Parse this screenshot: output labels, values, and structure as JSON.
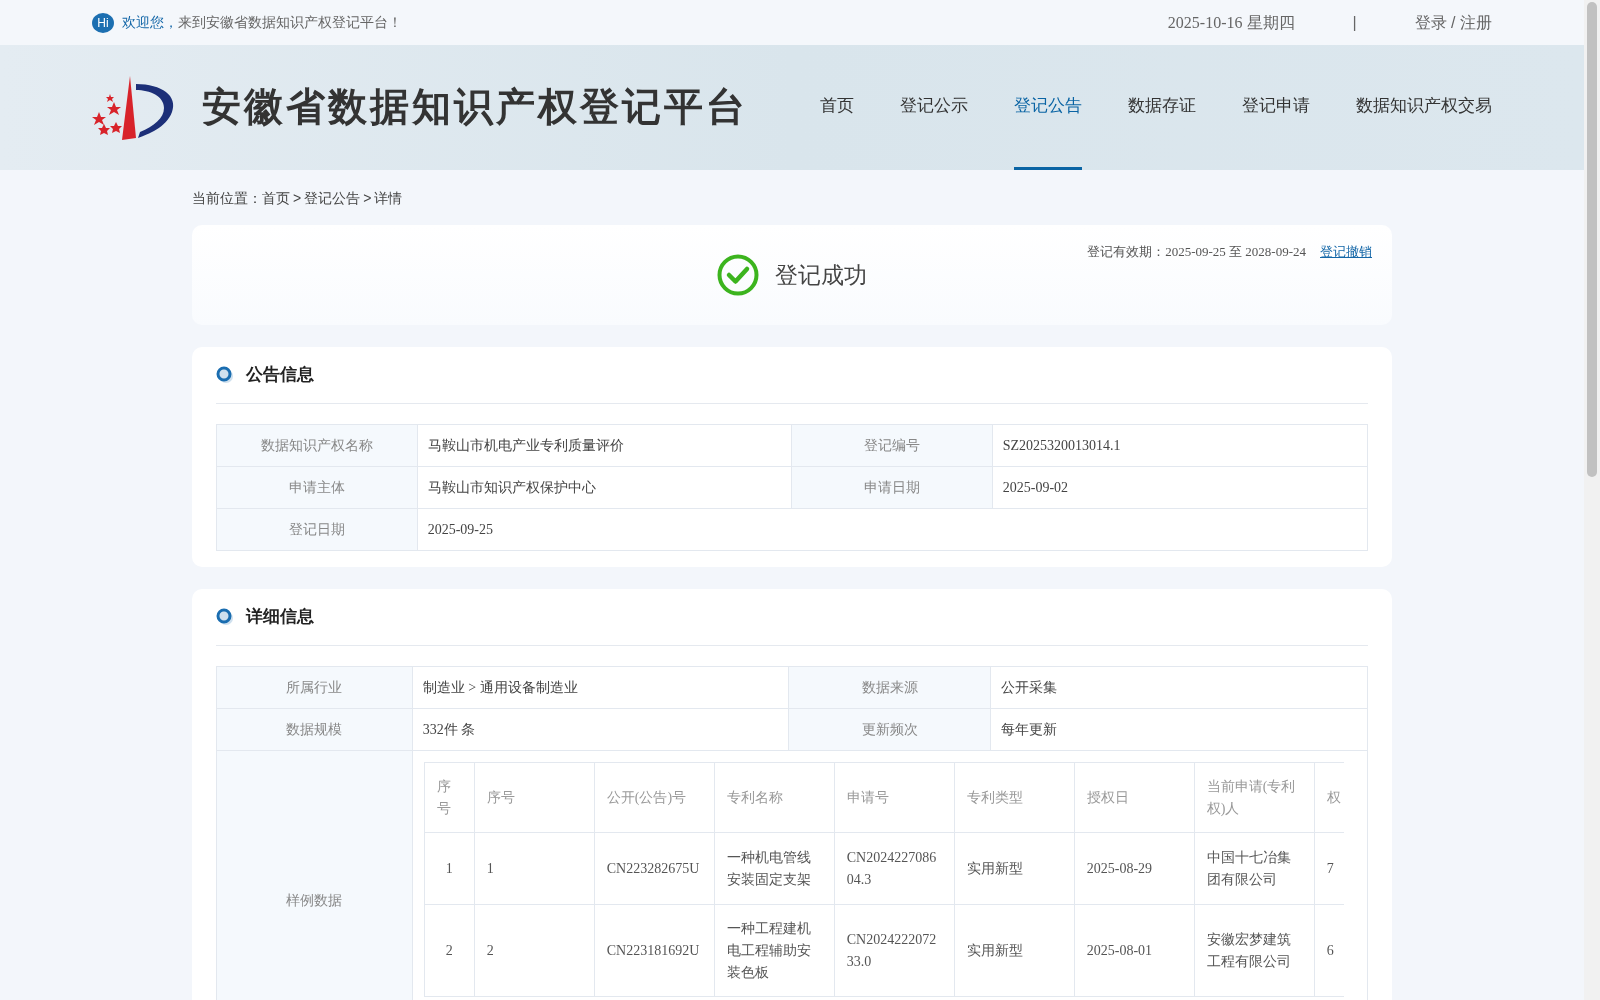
{
  "top_bar": {
    "hi_badge": "Hi",
    "welcome_highlight": "欢迎您，",
    "welcome_text": "来到安徽省数据知识产权登记平台！",
    "date": "2025-10-16 星期四",
    "separator": "|",
    "auth": "登录 / 注册"
  },
  "header": {
    "site_title": "安徽省数据知识产权登记平台",
    "nav": [
      {
        "label": "首页",
        "selected": false
      },
      {
        "label": "登记公示",
        "selected": false
      },
      {
        "label": "登记公告",
        "selected": true
      },
      {
        "label": "数据存证",
        "selected": false
      },
      {
        "label": "登记申请",
        "selected": false
      },
      {
        "label": "数据知识产权交易",
        "selected": false
      }
    ]
  },
  "breadcrumb": {
    "label": "当前位置：",
    "parts": [
      {
        "kind": "link",
        "text": "首页"
      },
      {
        "kind": "sep",
        "text": ">"
      },
      {
        "kind": "link",
        "text": "登记公告"
      },
      {
        "kind": "sep",
        "text": ">"
      },
      {
        "kind": "current",
        "text": "详情"
      }
    ]
  },
  "status": {
    "title": "登记成功",
    "validity_label": "登记有效期：",
    "validity": "2025-09-25 至 2028-09-24",
    "revoke_link": "登记撤销"
  },
  "sections": [
    {
      "title": "公告信息",
      "rows": [
        [
          {
            "label": "数据知识产权名称",
            "value": "马鞍山市机电产业专利质量评价"
          },
          {
            "label": "登记编号",
            "value": "SZ2025320013014.1"
          }
        ],
        [
          {
            "label": "申请主体",
            "value": "马鞍山市知识产权保护中心"
          },
          {
            "label": "申请日期",
            "value": "2025-09-02"
          }
        ],
        [
          {
            "label": "登记日期",
            "value": "2025-09-25"
          }
        ]
      ]
    },
    {
      "title": "详细信息",
      "rows": [
        [
          {
            "label": "所属行业",
            "value": "制造业 > 通用设备制造业"
          },
          {
            "label": "数据来源",
            "value": "公开采集"
          }
        ],
        [
          {
            "label": "数据规模",
            "value": "332件 条"
          },
          {
            "label": "更新频次",
            "value": "每年更新"
          }
        ]
      ],
      "sample": {
        "label": "样例数据",
        "columns": [
          "序号",
          "序号",
          "公开(公告)号",
          "专利名称",
          "申请号",
          "专利类型",
          "授权日",
          "当前申请(专利权)人",
          "权"
        ],
        "rows": [
          [
            "1",
            "1",
            "CN223282675U",
            "一种机电管线安装固定支架",
            "CN202422708604.3",
            "实用新型",
            "2025-08-29",
            "中国十七冶集团有限公司",
            "7"
          ],
          [
            "2",
            "2",
            "CN223181692U",
            "一种工程建机电工程辅助安装色板",
            "CN202422207233.0",
            "实用新型",
            "2025-08-01",
            "安徽宏梦建筑工程有限公司",
            "6"
          ]
        ]
      }
    }
  ]
}
